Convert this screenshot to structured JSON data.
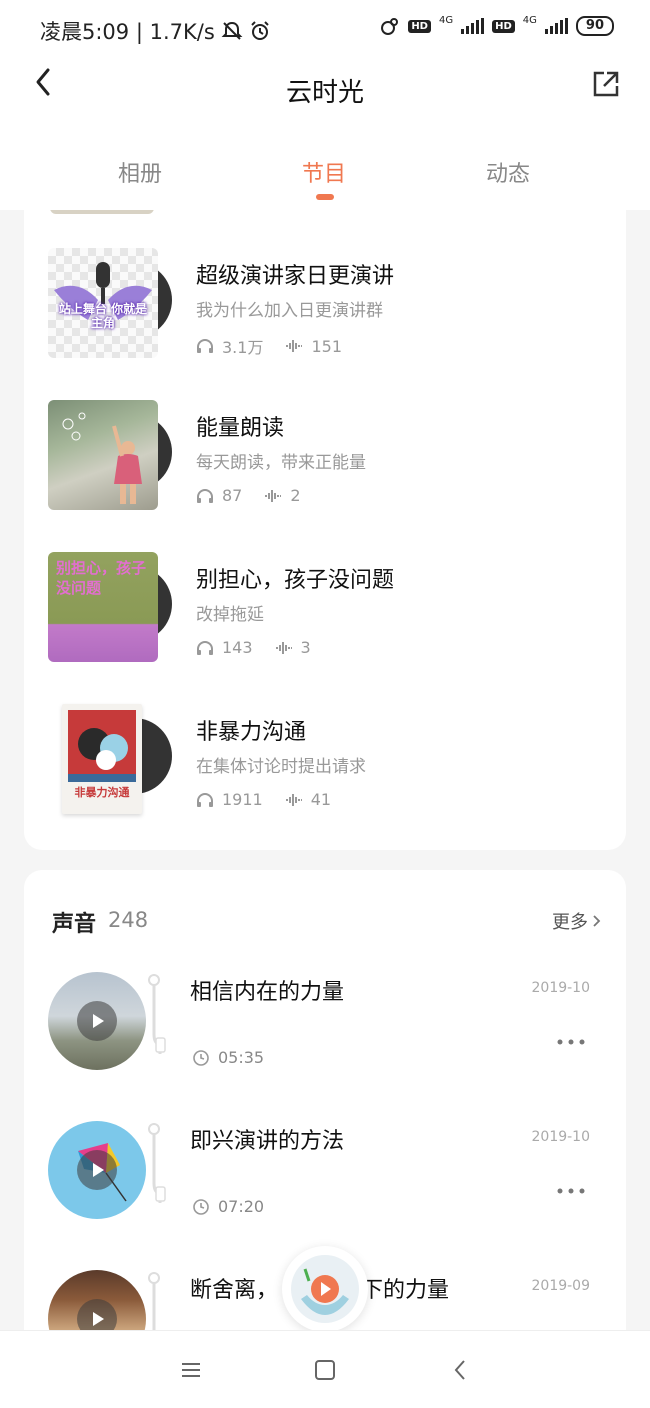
{
  "status_bar": {
    "time": "凌晨5:09 | 1.7K/s",
    "hd1": "HD",
    "hd2": "HD",
    "net1": "4G",
    "net2": "4G",
    "battery": "90"
  },
  "header": {
    "title": "云时光"
  },
  "tabs": [
    {
      "label": "相册"
    },
    {
      "label": "节目",
      "active": true
    },
    {
      "label": "动态"
    }
  ],
  "programs": [
    {
      "title": "超级演讲家日更演讲",
      "subtitle": "我为什么加入日更演讲群",
      "plays": "3.1万",
      "episodes": "151",
      "cover_text": "站上舞台 你就是主角"
    },
    {
      "title": "能量朗读",
      "subtitle": "每天朗读，带来正能量",
      "plays": "87",
      "episodes": "2"
    },
    {
      "title": "别担心，孩子没问题",
      "subtitle": "改掉拖延",
      "plays": "143",
      "episodes": "3",
      "cover_text": "别担心，孩子没问题"
    },
    {
      "title": "非暴力沟通",
      "subtitle": "在集体讨论时提出请求",
      "plays": "1911",
      "episodes": "41",
      "cover_text": "非暴力沟通"
    }
  ],
  "sounds": {
    "heading": "声音",
    "count": "248",
    "more_label": "更多",
    "items": [
      {
        "title": "相信内在的力量",
        "date": "2019-10",
        "duration": "05:35"
      },
      {
        "title": "即兴演讲的方法",
        "date": "2019-10",
        "duration": "07:20"
      },
      {
        "title": "断舍离，",
        "title_tail": "下的力量",
        "date": "2019-09"
      }
    ]
  },
  "colors": {
    "accent": "#f07850",
    "muted": "#999999"
  }
}
